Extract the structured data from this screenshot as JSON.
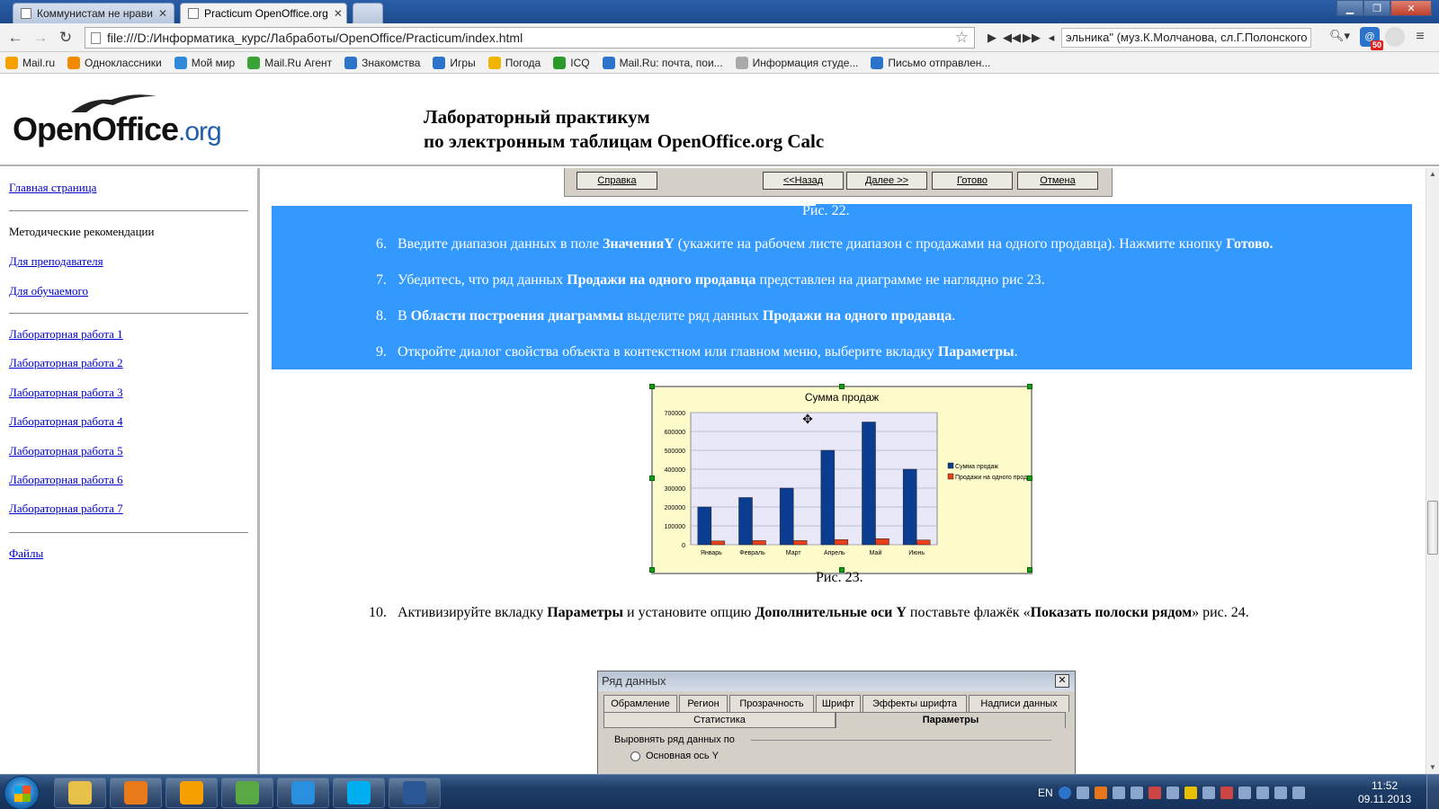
{
  "browser": {
    "tabs": [
      {
        "label": "Коммунистам не нрави"
      },
      {
        "label": "Practicum OpenOffice.org"
      }
    ],
    "url": "file:///D:/Информатика_курс/Лабработы/OpenOffice/Practicum/index.html",
    "media_track": "эльника\" (муз.К.Молчанова, сл.Г.Полонского",
    "extension_badge": "50",
    "bookmarks": [
      {
        "label": "Mail.ru",
        "icon": "mail-at-icon",
        "color": "#f6a000"
      },
      {
        "label": "Одноклассники",
        "icon": "odnoklassniki-icon",
        "color": "#f28a00"
      },
      {
        "label": "Мой мир",
        "icon": "moi-mir-icon",
        "color": "#2f8ad8"
      },
      {
        "label": "Mail.Ru Агент",
        "icon": "agent-icon",
        "color": "#3aa335"
      },
      {
        "label": "Знакомства",
        "icon": "dating-at-icon",
        "color": "#2b74c9"
      },
      {
        "label": "Игры",
        "icon": "games-at-icon",
        "color": "#2b74c9"
      },
      {
        "label": "Погода",
        "icon": "weather-sun-icon",
        "color": "#f0b400"
      },
      {
        "label": "ICQ",
        "icon": "icq-flower-icon",
        "color": "#2a9a2a"
      },
      {
        "label": "Mail.Ru: почта, пои...",
        "icon": "mail-at-icon",
        "color": "#2b74c9"
      },
      {
        "label": "Информация студе...",
        "icon": "page-icon",
        "color": "#aaaaaa"
      },
      {
        "label": "Письмо отправлен...",
        "icon": "mail-at-icon",
        "color": "#2b74c9"
      }
    ]
  },
  "header": {
    "logo_text": "OpenOffice",
    "logo_suffix": ".org",
    "title_line1": "Лабораторный практикум",
    "title_line2": "по электронным таблицам OpenOffice.org Calc"
  },
  "sidebar": {
    "home": "Главная страница",
    "methodical": "Методические рекомендации",
    "for_teacher": "Для преподавателя",
    "for_student": "Для обучаемого",
    "labs": [
      "Лабораторная работа 1",
      "Лабораторная работа 2",
      "Лабораторная работа 3",
      "Лабораторная работа 4",
      "Лабораторная работа 5",
      "Лабораторная работа 6",
      "Лабораторная работа 7"
    ],
    "files": "Файлы"
  },
  "wizard_buttons": {
    "help": "Справка",
    "back": "<<Назад",
    "next": "Далее >>",
    "finish": "Готово",
    "cancel": "Отмена"
  },
  "content": {
    "fig22": "Рис. 22.",
    "fig23": "Рис. 23.",
    "steps": [
      {
        "num": "6.",
        "parts": [
          {
            "t": "Введите диапазон данных в поле "
          },
          {
            "t": "ЗначенияY",
            "b": true
          },
          {
            "t": " (укажите на рабочем листе диапазон с продажами на одного продавца). Нажмите кнопку "
          },
          {
            "t": "Готово.",
            "b": true
          }
        ]
      },
      {
        "num": "7.",
        "parts": [
          {
            "t": "Убедитесь, что ряд данных "
          },
          {
            "t": "Продажи на одного продавца",
            "b": true
          },
          {
            "t": " представлен на диаграмме не наглядно рис 23."
          }
        ]
      },
      {
        "num": "8.",
        "parts": [
          {
            "t": "В "
          },
          {
            "t": "Области построения диаграммы",
            "b": true
          },
          {
            "t": " выделите ряд данных "
          },
          {
            "t": "Продажи на одного продавца",
            "b": true
          },
          {
            "t": "."
          }
        ]
      },
      {
        "num": "9.",
        "parts": [
          {
            "t": "Откройте диалог свойства объекта в контекстном или главном меню, выберите вкладку "
          },
          {
            "t": "Параметры",
            "b": true
          },
          {
            "t": "."
          }
        ]
      },
      {
        "num": "10.",
        "parts": [
          {
            "t": "Активизируйте вкладку "
          },
          {
            "t": "Параметры",
            "b": true
          },
          {
            "t": " и установите опцию "
          },
          {
            "t": "Дополнительные оси Y",
            "b": true
          },
          {
            "t": " поставьте флажёк «"
          },
          {
            "t": "Показать полоски рядом",
            "b": true
          },
          {
            "t": "» рис. 24."
          }
        ]
      }
    ]
  },
  "chart_data": {
    "type": "bar",
    "title": "Сумма продаж",
    "categories": [
      "Январь",
      "Февраль",
      "Март",
      "Апрель",
      "Май",
      "Июнь"
    ],
    "series": [
      {
        "name": "Сумма продаж",
        "color": "#0a3d8f",
        "values": [
          200000,
          250000,
          300000,
          500000,
          650000,
          400000
        ]
      },
      {
        "name": "Продажи на одного продавца",
        "color": "#e8401a",
        "values": [
          20000,
          22000,
          22000,
          27000,
          32000,
          25000
        ]
      }
    ],
    "ylim": [
      0,
      700000
    ],
    "yticks": [
      "0",
      "100000",
      "200000",
      "300000",
      "400000",
      "500000",
      "600000",
      "700000"
    ],
    "grid": true,
    "legend": "right",
    "plot_bg": "#e8e8f8",
    "chart_bg": "#fffccc"
  },
  "dialog": {
    "title": "Ряд данных",
    "tabs_row1": [
      "Обрамление",
      "Регион",
      "Прозрачность",
      "Шрифт",
      "Эффекты шрифта",
      "Надписи данных"
    ],
    "tab_statistics": "Статистика",
    "tab_parameters": "Параметры",
    "group_label": "Выровнять ряд данных по",
    "radio_label": "Основная ось Y"
  },
  "taskbar": {
    "apps": [
      {
        "name": "explorer-icon",
        "color": "#e8c14a"
      },
      {
        "name": "media-player-icon",
        "color": "#e87a1a"
      },
      {
        "name": "mail-agent-icon",
        "color": "#f6a000"
      },
      {
        "name": "chrome-icon",
        "color": "#5aa843"
      },
      {
        "name": "internet-explorer-icon",
        "color": "#2b8fe0"
      },
      {
        "name": "skype-icon",
        "color": "#00aff0"
      },
      {
        "name": "word-icon",
        "color": "#2b5797"
      }
    ],
    "lang": "EN",
    "time": "11:52",
    "date": "09.11.2013"
  }
}
